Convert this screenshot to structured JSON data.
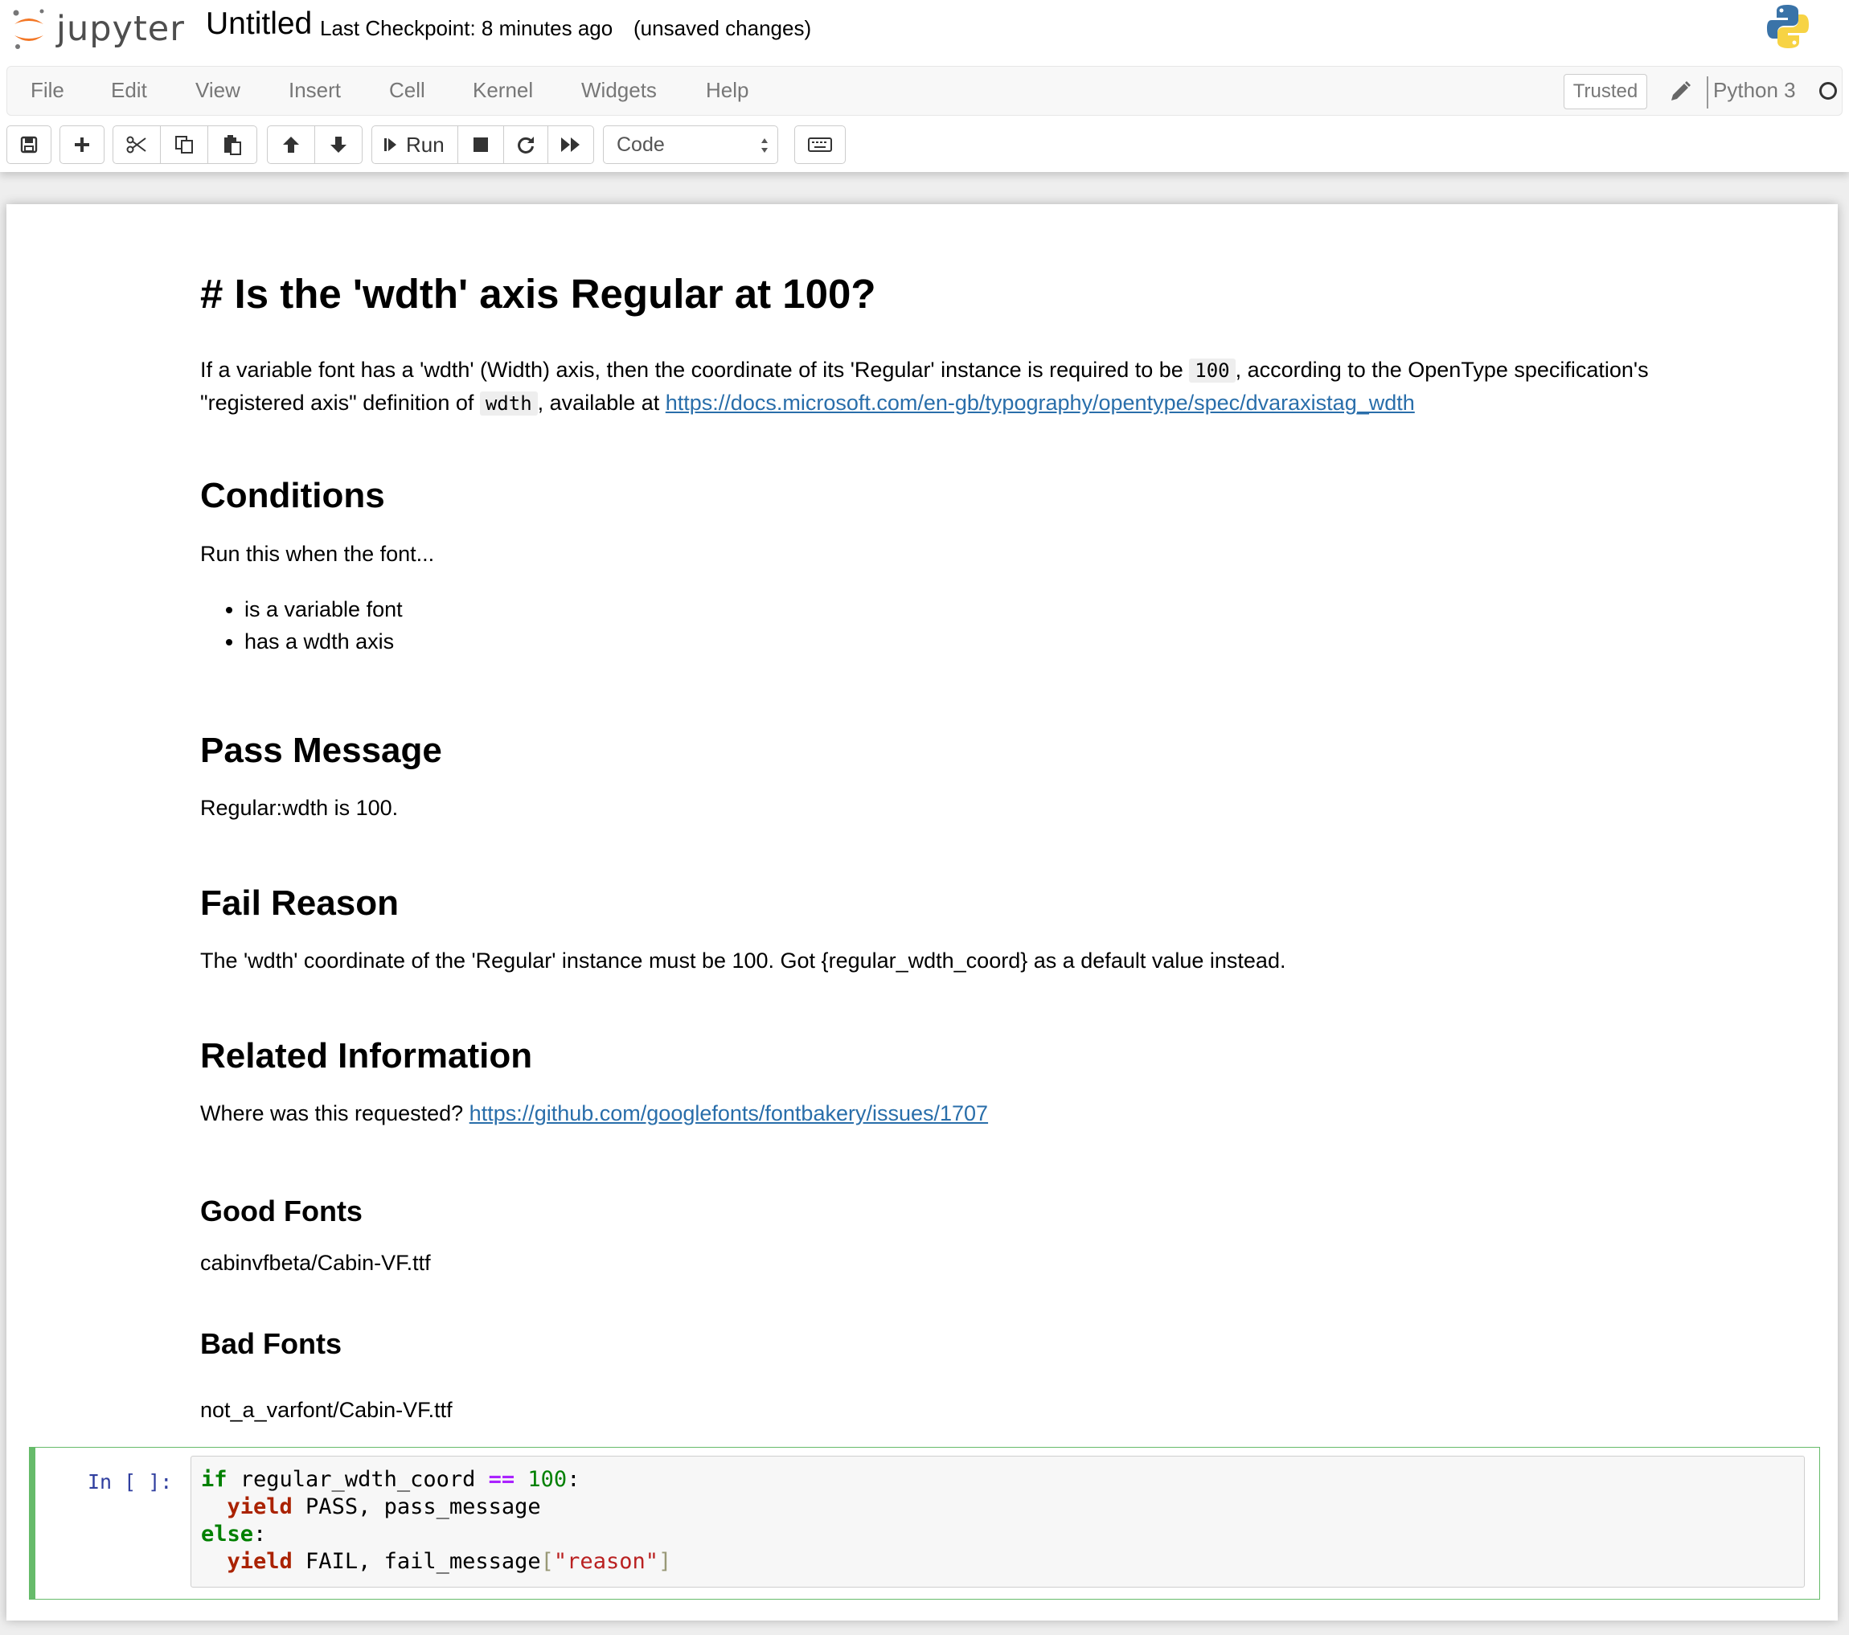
{
  "header": {
    "logo_text": "jupyter",
    "notebook_name": "Untitled",
    "checkpoint": "Last Checkpoint: 8 minutes ago",
    "unsaved": "(unsaved changes)"
  },
  "menubar": {
    "items": [
      "File",
      "Edit",
      "View",
      "Insert",
      "Cell",
      "Kernel",
      "Widgets",
      "Help"
    ],
    "trusted": "Trusted",
    "kernel_name": "Python 3"
  },
  "toolbar": {
    "run_label": "Run",
    "cell_type": "Code"
  },
  "markdown": {
    "title": "# Is the 'wdth' axis Regular at 100?",
    "intro_1": "If a variable font has a 'wdth' (Width) axis, then the coordinate of its 'Regular' instance is required to be ",
    "intro_code_1": "100",
    "intro_2": ", according to the OpenType specification's",
    "intro_3": "\"registered axis\" definition of ",
    "intro_code_2": "wdth",
    "intro_4": ", available at ",
    "intro_link": "https://docs.microsoft.com/en-gb/typography/opentype/spec/dvaraxistag_wdth",
    "conditions_heading": "Conditions",
    "conditions_text": "Run this when the font...",
    "conditions_items": [
      "is a variable font",
      "has a wdth axis"
    ],
    "pass_heading": "Pass Message",
    "pass_text": "Regular:wdth is 100.",
    "fail_heading": "Fail Reason",
    "fail_text": "The 'wdth' coordinate of the 'Regular' instance must be 100. Got {regular_wdth_coord} as a default value instead.",
    "related_heading": "Related Information",
    "related_text": "Where was this requested? ",
    "related_link": "https://github.com/googlefonts/fontbakery/issues/1707",
    "good_heading": "Good Fonts",
    "good_text": "cabinvfbeta/Cabin-VF.ttf",
    "bad_heading": "Bad Fonts",
    "bad_text": "not_a_varfont/Cabin-VF.ttf"
  },
  "code_cell": {
    "prompt": "In [ ]:",
    "line1_kw": "if",
    "line1_var": " regular_wdth_coord ",
    "line1_op": "==",
    "line1_sp": " ",
    "line1_num": "100",
    "line1_end": ":",
    "line2_indent": "  ",
    "line2_kw": "yield",
    "line2_rest": " PASS, pass_message",
    "line3_kw": "else",
    "line3_end": ":",
    "line4_indent": "  ",
    "line4_kw": "yield",
    "line4_rest": " FAIL, fail_message",
    "line4_open": "[",
    "line4_str": "\"reason\"",
    "line4_close": "]"
  }
}
